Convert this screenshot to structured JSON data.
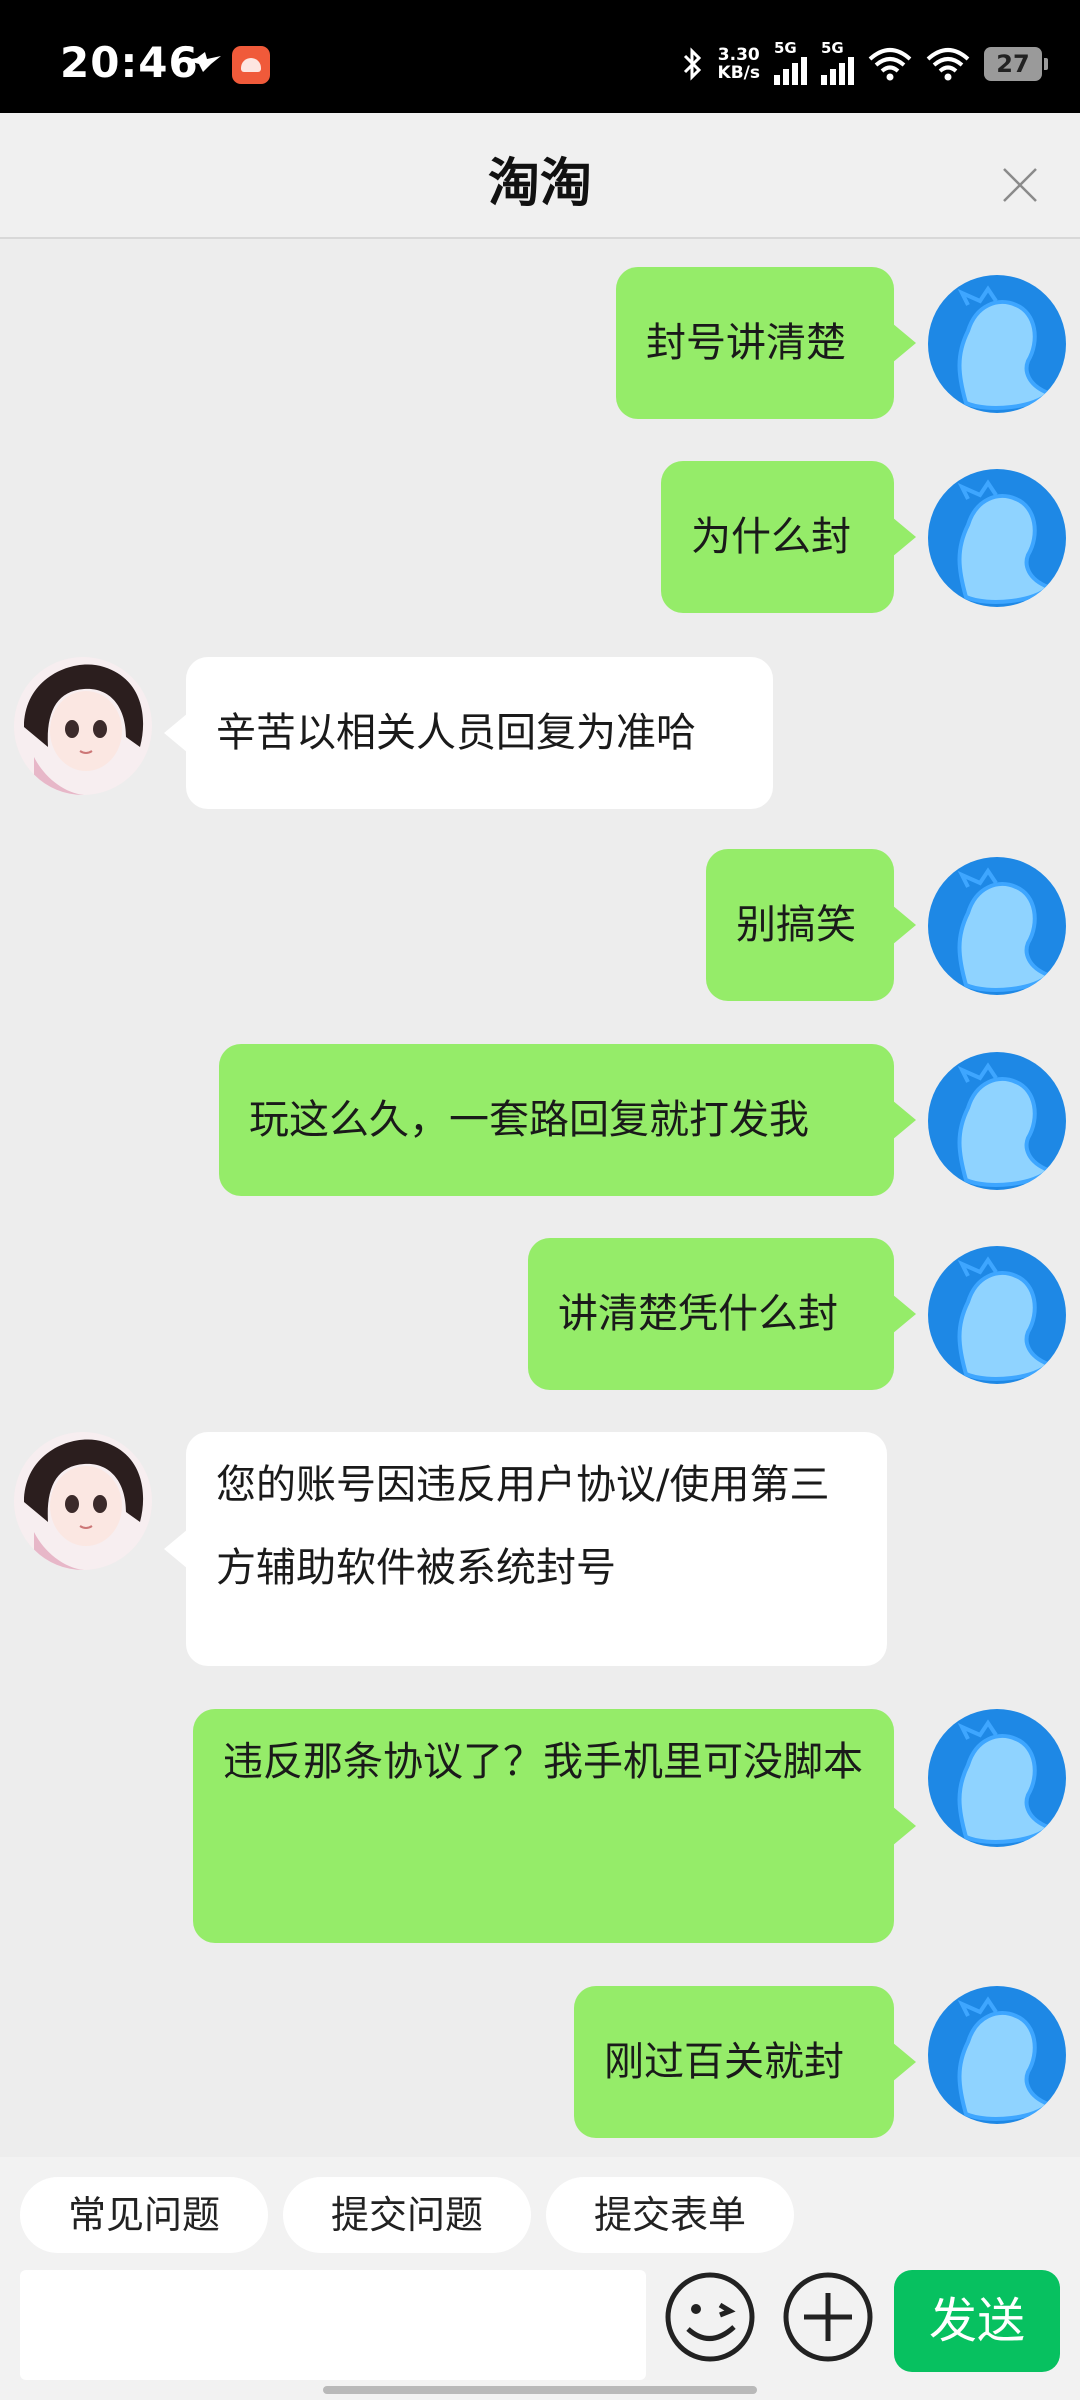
{
  "status_bar": {
    "time": "20:46",
    "net_speed": "3.30",
    "net_unit": "KB/s",
    "sim1_gen": "5G",
    "sim2_gen": "5G",
    "battery": "27",
    "icons": [
      "bird-notification-icon",
      "app-notification-icon",
      "bluetooth-icon",
      "signal-icon",
      "signal-icon",
      "wifi-icon",
      "wifi-icon",
      "battery-icon"
    ]
  },
  "header": {
    "title": "淘淘"
  },
  "messages": [
    {
      "side": "user",
      "text": "封号讲清楚"
    },
    {
      "side": "user",
      "text": "为什么封"
    },
    {
      "side": "agent",
      "text": "辛苦以相关人员回复为准哈"
    },
    {
      "side": "user",
      "text": "别搞笑"
    },
    {
      "side": "user",
      "text": "玩这么久，一套路回复就打发我"
    },
    {
      "side": "user",
      "text": "讲清楚凭什么封"
    },
    {
      "side": "agent",
      "text": "您的账号因违反用户协议/使用第三方辅助软件被系统封号"
    },
    {
      "side": "user",
      "text": "违反那条协议了？我手机里可没脚本"
    },
    {
      "side": "user",
      "text": "刚过百关就封"
    }
  ],
  "quick_actions": [
    "常见问题",
    "提交问题",
    "提交表单"
  ],
  "composer": {
    "input_value": "",
    "send_label": "发送"
  },
  "colors": {
    "user_bubble": "#95ec69",
    "agent_bubble": "#ffffff",
    "send_button": "#07c160",
    "background": "#ededed"
  }
}
